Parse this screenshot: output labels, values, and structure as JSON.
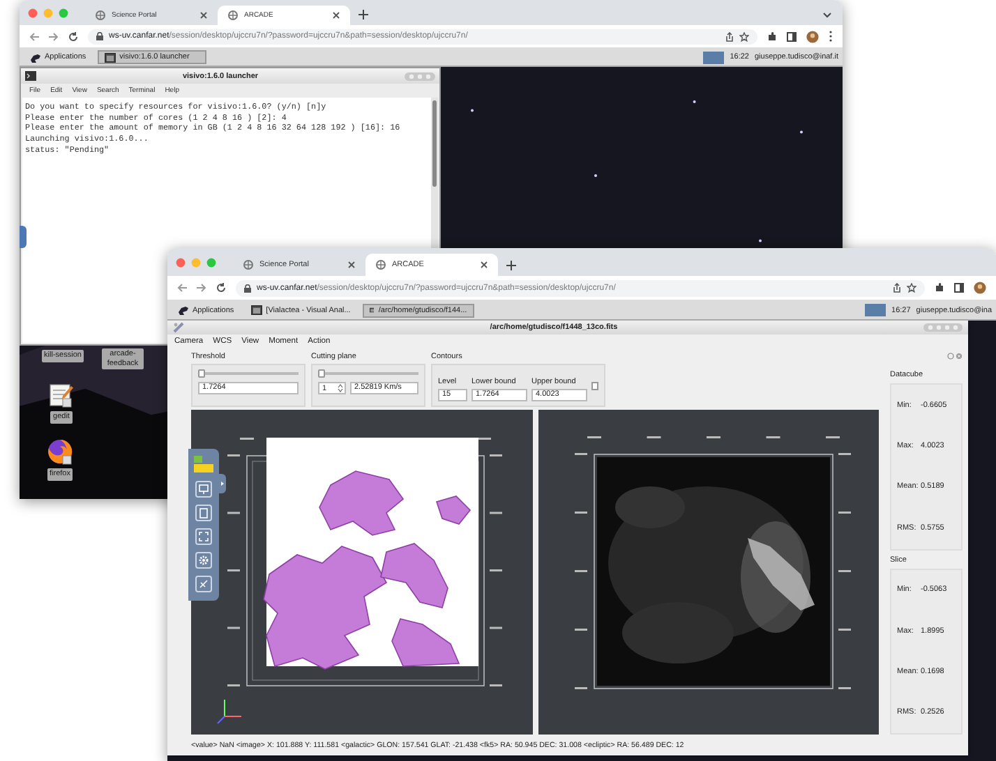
{
  "back_window": {
    "tabs": [
      {
        "label": "Science Portal",
        "selected": false
      },
      {
        "label": "ARCADE",
        "selected": true
      }
    ],
    "url": {
      "host": "ws-uv.canfar.net",
      "path": "/session/desktop/ujccru7n/?password=ujccru7n&path=session/desktop/ujccru7n/"
    },
    "taskbar": {
      "menu_label": "Applications",
      "tasks": [
        {
          "label": "visivo:1.6.0 launcher",
          "selected": true
        }
      ],
      "clock": "16:22",
      "user": "giuseppe.tudisco@inaf.it"
    },
    "terminal": {
      "title": "visivo:1.6.0 launcher",
      "menu": [
        "File",
        "Edit",
        "View",
        "Search",
        "Terminal",
        "Help"
      ],
      "lines": [
        "Do you want to specify resources for visivo:1.6.0? (y/n) [n]y",
        "Please enter the number of cores (1 2 4 8 16 ) [2]: 4",
        "Please enter the amount of memory in GB (1 2 4 8 16 32 64 128 192 ) [16]: 16",
        "Launching visivo:1.6.0...",
        "status: \"Pending\""
      ]
    },
    "desktop_icons": [
      {
        "label": "kill-session",
        "kind": "covered"
      },
      {
        "label": "arcade-feedback",
        "kind": "covered"
      },
      {
        "label": "gedit",
        "kind": "text-editor"
      },
      {
        "label": "firefox",
        "kind": "web-browser"
      }
    ]
  },
  "front_window": {
    "tabs": [
      {
        "label": "Science Portal",
        "selected": false
      },
      {
        "label": "ARCADE",
        "selected": true
      }
    ],
    "url": {
      "host": "ws-uv.canfar.net",
      "path": "/session/desktop/ujccru7n/?password=ujccru7n&path=session/desktop/ujccru7n/"
    },
    "taskbar": {
      "menu_label": "Applications",
      "tasks": [
        {
          "label": "[Vialactea - Visual Anal...",
          "selected": false
        },
        {
          "label": "/arc/home/gtudisco/f144...",
          "selected": true
        }
      ],
      "clock": "16:27",
      "user": "giuseppe.tudisco@ina"
    },
    "viewer": {
      "title": "/arc/home/gtudisco/f1448_13co.fits",
      "menu": [
        "Camera",
        "WCS",
        "View",
        "Moment",
        "Action"
      ],
      "threshold": {
        "label": "Threshold",
        "level": 0,
        "value": "1.7264"
      },
      "cutting_plane": {
        "label": "Cutting plane",
        "level": 0,
        "channel": "1",
        "velocity": "2.52819 Km/s"
      },
      "contours": {
        "label": "Contours",
        "checked": false,
        "fields": [
          {
            "label": "Level",
            "value": "15"
          },
          {
            "label": "Lower bound",
            "value": "1.7264"
          },
          {
            "label": "Upper bound",
            "value": "4.0023"
          }
        ]
      },
      "stat_panels": [
        {
          "title": "Datacube",
          "stats": [
            {
              "label": "Min:",
              "value": "-0.6605"
            },
            {
              "label": "Max:",
              "value": "4.0023"
            },
            {
              "label": "Mean:",
              "value": "0.5189"
            },
            {
              "label": "RMS:",
              "value": "0.5755"
            }
          ]
        },
        {
          "title": "Slice",
          "stats": [
            {
              "label": "Min:",
              "value": "-0.5063"
            },
            {
              "label": "Max:",
              "value": "1.8995"
            },
            {
              "label": "Mean:",
              "value": "0.1698"
            },
            {
              "label": "RMS:",
              "value": "0.2526"
            }
          ]
        }
      ],
      "status_bar": "<value> NaN <image> X: 101.888 Y: 111.581 <galactic> GLON: 157.541 GLAT: -21.438 <fk5> RA: 50.945 DEC: 31.008 <ecliptic> RA: 56.489 DEC: 12"
    }
  }
}
